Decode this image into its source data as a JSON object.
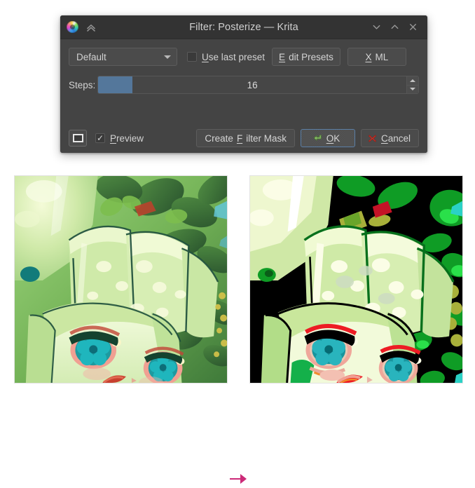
{
  "window": {
    "title": "Filter: Posterize — Krita",
    "app_icon": "krita-logo-icon",
    "collapse_icon": "double-chevron-up-icon",
    "controls": [
      {
        "name": "shade-button",
        "icon": "chevron-down-icon"
      },
      {
        "name": "unshade-button",
        "icon": "chevron-up-icon"
      },
      {
        "name": "close-button",
        "icon": "close-x-icon"
      }
    ]
  },
  "preset_row": {
    "combo_value": "Default",
    "combo_options": [
      "Default"
    ],
    "dropdown_icon": "chevron-down-icon",
    "use_last_preset": {
      "label_prefix": "",
      "label_accel": "U",
      "label_rest": "se last preset",
      "checked": false,
      "check_glyph": ""
    },
    "edit_presets": {
      "label_prefix": "",
      "label_accel": "E",
      "label_rest": "dit Presets"
    },
    "xml": {
      "label_prefix": "",
      "label_accel": "X",
      "label_rest": "ML"
    }
  },
  "steps_row": {
    "label": "Steps:",
    "value": "16",
    "value_number": 16,
    "minimum": 2,
    "maximum": 128,
    "fill_percent": 11,
    "fill_color": "#54779b",
    "spin_up_icon": "triangle-up-icon",
    "spin_down_icon": "triangle-down-icon"
  },
  "footer": {
    "preview_toggle_icon": "preview-rectangle-icon",
    "preview_checkbox": {
      "checked": true,
      "check_glyph": "✓",
      "label_prefix": "",
      "label_accel": "P",
      "label_rest": "review"
    },
    "create_filter_mask": {
      "label_prefix": "Create ",
      "label_accel": "F",
      "label_rest": "ilter Mask"
    },
    "ok": {
      "label_prefix": "",
      "label_accel": "O",
      "label_rest": "K",
      "icon": "enter-arrow-icon",
      "focused": true,
      "focus_border_color": "#5b7fa6"
    },
    "cancel": {
      "label_prefix": "",
      "label_accel": "C",
      "label_rest": "ancel",
      "icon": "red-x-icon"
    }
  },
  "comparison": {
    "arrow_icon": "arrow-right-icon",
    "arrow_color": "#cc2a78",
    "before": {
      "name": "original-artwork-preview",
      "description": "Original artwork: green-haired anime character among leaves, smooth gradients"
    },
    "after": {
      "name": "posterized-artwork-preview",
      "description": "Posterize filter applied with 16 steps: flat banded colors, dark areas crushed to black"
    }
  },
  "palette": {
    "titlebar_bg": "#333333",
    "dialog_bg": "#444444",
    "button_bg": "#4b4b4b",
    "button_border": "#5c5c5c",
    "text": "#d2d2d2",
    "accent_blue": "#54779b",
    "page_bg": "#ffffff"
  }
}
